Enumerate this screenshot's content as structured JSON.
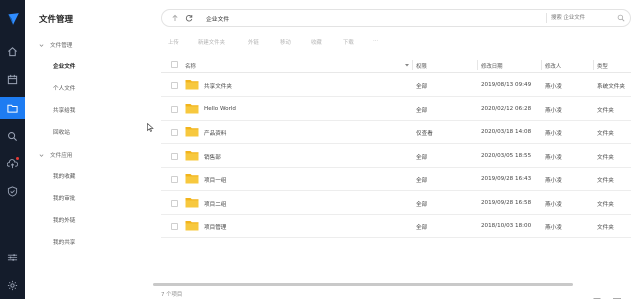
{
  "nav": {
    "title": "文件管理",
    "groups": [
      {
        "label": "文件管理",
        "children": [
          "企业文件",
          "个人文件",
          "共享给我",
          "回收站"
        ]
      },
      {
        "label": "文件应用",
        "children": [
          "我的收藏",
          "我的审批",
          "我的外链",
          "我的共享"
        ]
      }
    ],
    "selected": "企业文件"
  },
  "pathbar": {
    "path": "企业文件",
    "search_placeholder": "搜索 企业文件"
  },
  "toolbar": {
    "upload": "上传",
    "new_folder": "新建文件夹",
    "share": "外链",
    "move": "移动",
    "favorite": "收藏",
    "download": "下载",
    "more": "···"
  },
  "table": {
    "headers": {
      "name": "名称",
      "permission": "权限",
      "modified": "修改日期",
      "modifier": "修改人",
      "type": "类型"
    },
    "rows": [
      {
        "name": "共享文件夹",
        "permission": "全部",
        "modified": "2019/08/13 09:49",
        "modifier": "燕小凌",
        "type": "系统文件夹"
      },
      {
        "name": "Hello World",
        "permission": "全部",
        "modified": "2020/02/12 06:28",
        "modifier": "燕小凌",
        "type": "文件夹"
      },
      {
        "name": "产品资料",
        "permission": "仅查看",
        "modified": "2020/03/18 14:08",
        "modifier": "燕小凌",
        "type": "文件夹"
      },
      {
        "name": "销售部",
        "permission": "全部",
        "modified": "2020/03/05 18:55",
        "modifier": "燕小凌",
        "type": "文件夹"
      },
      {
        "name": "项目一组",
        "permission": "全部",
        "modified": "2019/09/28 16:43",
        "modifier": "燕小凌",
        "type": "文件夹"
      },
      {
        "name": "项目二组",
        "permission": "全部",
        "modified": "2019/09/28 16:58",
        "modifier": "燕小凌",
        "type": "文件夹"
      },
      {
        "name": "项目管理",
        "permission": "全部",
        "modified": "2018/10/03 18:00",
        "modifier": "燕小凌",
        "type": "文件夹"
      }
    ]
  },
  "status": {
    "item_count": "7 个项目"
  },
  "colors": {
    "rail_bg": "#141c2b",
    "rail_active": "#1e7cf2",
    "folder": "#f7c12e",
    "accent": "#1e7cf2"
  },
  "icons": {
    "rail": [
      "logo-icon",
      "home-icon",
      "calendar-icon",
      "folder-icon",
      "search-icon",
      "upload-cloud-icon",
      "shield-icon",
      "sliders-icon",
      "settings-icon"
    ]
  }
}
